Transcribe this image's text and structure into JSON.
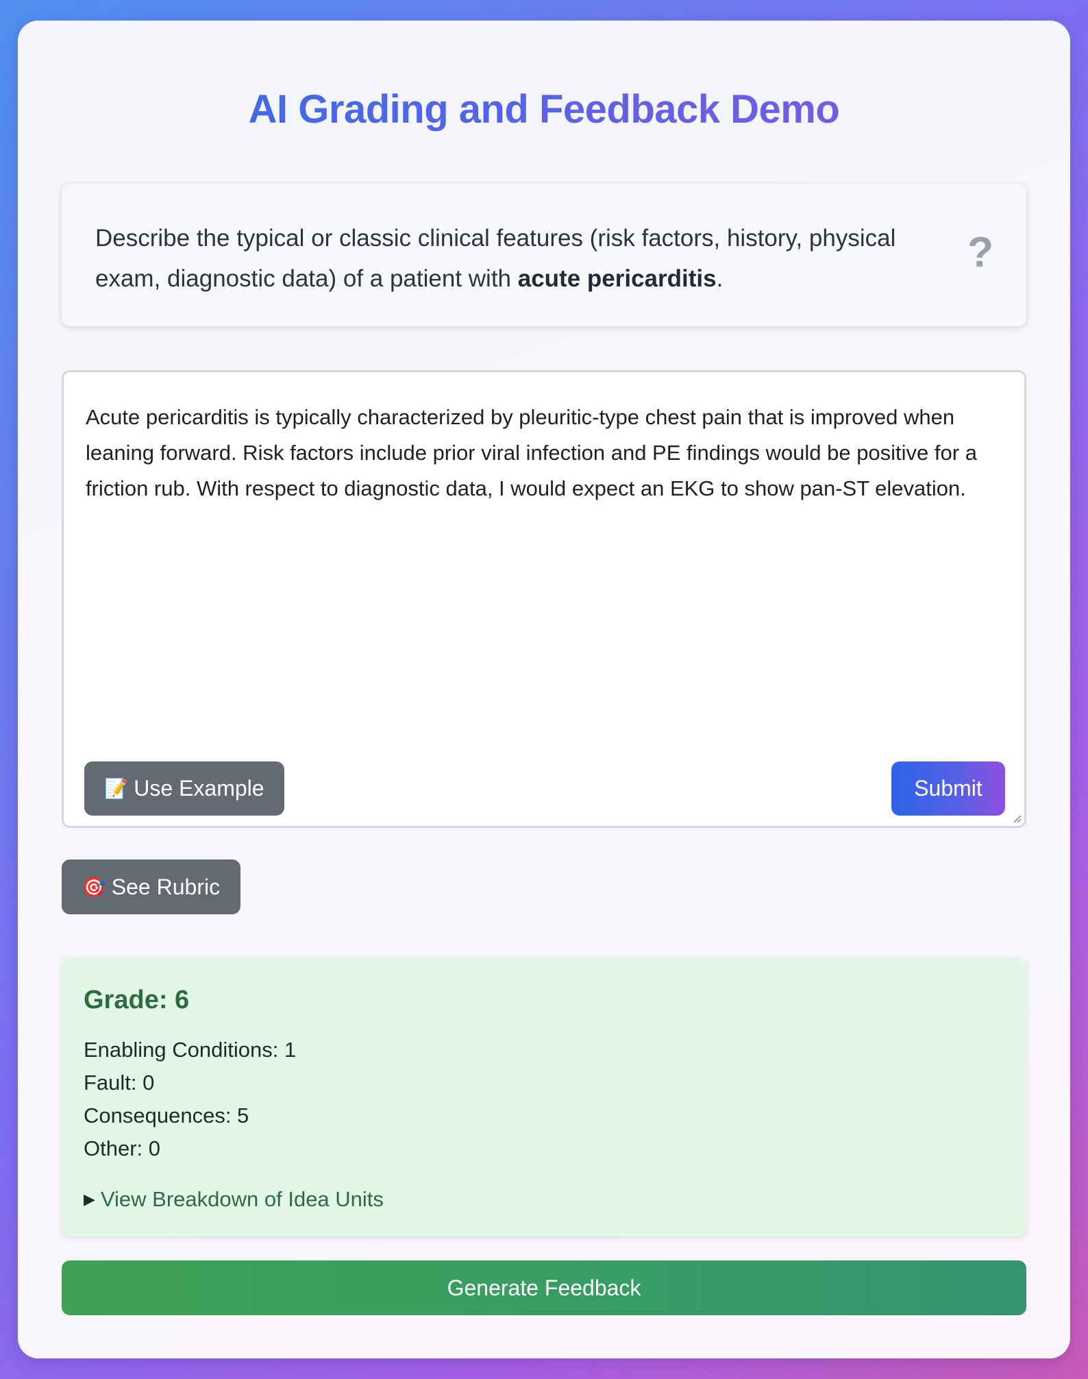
{
  "header": {
    "title": "AI Grading and Feedback Demo"
  },
  "question": {
    "text_before": "Describe the typical or classic clinical features (risk factors, history, physical exam, diagnostic data) of a patient with ",
    "emphasis": "acute pericarditis",
    "text_after": ".",
    "help_icon_glyph": "?"
  },
  "answer": {
    "text": "Acute pericarditis is typically characterized by pleuritic-type chest pain that is improved when leaning forward. Risk factors include prior viral infection and PE findings would be positive for a friction rub. With respect to diagnostic data, I would expect an EKG to show pan-ST elevation."
  },
  "buttons": {
    "use_example_icon": "📝",
    "use_example_label": "Use Example",
    "submit_label": "Submit",
    "see_rubric_icon": "🎯",
    "see_rubric_label": "See Rubric",
    "generate_feedback_label": "Generate Feedback"
  },
  "grade": {
    "title": "Grade: 6",
    "lines": [
      "Enabling Conditions: 1",
      "Fault: 0",
      "Consequences: 5",
      "Other: 0"
    ],
    "breakdown_arrow": "▶",
    "breakdown_label": "View Breakdown of Idea Units"
  },
  "colors": {
    "title_gradient_start": "#2f6fe4",
    "title_gradient_end": "#8d55e6",
    "grade_background": "#e3f7e8",
    "grade_text": "#2e6b3d",
    "gray_button": "#636a74",
    "generate_button": "#3fa153"
  }
}
